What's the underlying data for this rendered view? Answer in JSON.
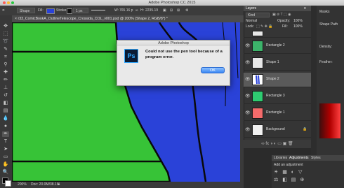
{
  "window": {
    "title": "Adobe Photoshop CC 2015"
  },
  "options": {
    "mode": "Shape",
    "fill_label": "Fill:",
    "stroke_label": "Stroke:",
    "stroke_width": "1 px",
    "w_label": "W:",
    "w_value": "765.16 p",
    "h_label": "H:",
    "h_value": "2235.19",
    "fill_color": "#2a42d8"
  },
  "document": {
    "tab_title": "r33_ComicBookA_OutlineTelescope_Crossida_COL_v001.psd @ 200% (Shape 2, RGB/8*) *",
    "status": "Doc: 20.0M/38.1M",
    "canvas_color": "#2a42d8",
    "green_color": "#37c337"
  },
  "dialog": {
    "title": "Adobe Photoshop",
    "icon_text": "Ps",
    "message": "Could not use the pen tool because of a program error.",
    "ok_label": "OK"
  },
  "layers_panel": {
    "tab": "Layers",
    "kind": "Kind",
    "blend": "Normal",
    "opacity_label": "Opacity:",
    "opacity": "100%",
    "lock_label": "Lock:",
    "fill_label": "Fill:",
    "fill": "100%",
    "layers": [
      {
        "name": "Rectangle 2",
        "color": "#3cb36a"
      },
      {
        "name": "Shape 1",
        "color": "#e8e8e8"
      },
      {
        "name": "Shape 2",
        "color": "#ffffff"
      },
      {
        "name": "Rectangle 3",
        "color": "#2ecc71"
      },
      {
        "name": "Rectangle 1",
        "color": "#f46b6b"
      },
      {
        "name": "Background",
        "color": "#f0f0f0"
      }
    ]
  },
  "right_panels": {
    "masks": "Masks",
    "shape_path": "Shape Path",
    "density": "Density:",
    "feather": "Feather:"
  },
  "bottom_panels": {
    "libraries": "Libraries",
    "adjustments": "Adjustments",
    "styles": "Styles",
    "add_adjustment": "Add an adjustment"
  }
}
